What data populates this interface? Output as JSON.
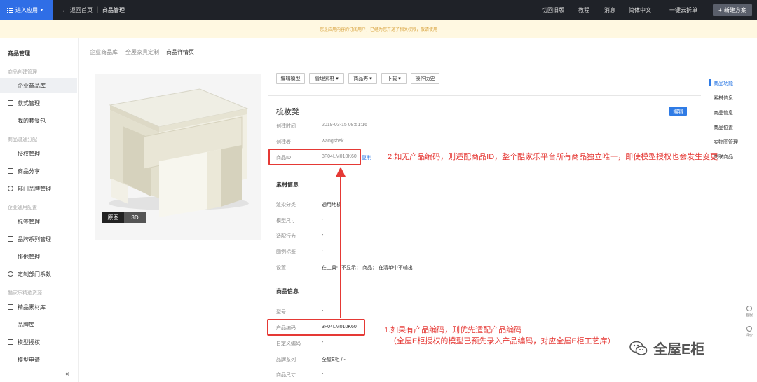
{
  "topbar": {
    "app_button": "进入应用",
    "back": "返回首页",
    "title": "商品管理",
    "right_items": [
      "切回旧版",
      "教程",
      "消息",
      "简体中文",
      "一键云拆单"
    ],
    "new_plan": "新建方案"
  },
  "notice": "您是应用内容的订阅用户，已经为您开通了相关权限，敬请使用",
  "sidebar": {
    "title": "商品管理",
    "groups": [
      {
        "label": "商品创建管理",
        "items": [
          "企业商品库",
          "款式管理",
          "我的套餐包"
        ]
      },
      {
        "label": "商品流通分配",
        "items": [
          "授权管理",
          "商品分享",
          "部门品牌管理"
        ]
      },
      {
        "label": "企业通用配置",
        "items": [
          "标签管理",
          "品牌系列管理",
          "排他管理",
          "定制部门系数"
        ]
      },
      {
        "label": "酷家乐精选资源",
        "items": [
          "精品素材库",
          "品牌库",
          "模型授权",
          "模型申请"
        ]
      }
    ],
    "collapse": "«"
  },
  "breadcrumb": [
    "企业商品库",
    "全屋家具定制",
    "商品详情页"
  ],
  "image_tabs": [
    "原图",
    "3D"
  ],
  "toolbar": [
    "编辑模型",
    "管理素材 ▾",
    "商品秀 ▾",
    "下载 ▾",
    "操作历史"
  ],
  "product": {
    "name": "梳妆凳",
    "edit": "编辑",
    "created_label": "创建时间",
    "created_value": "2019-03-15 08:51:16",
    "creator_label": "创建者",
    "creator_value": "wangshek",
    "id_label": "商品ID",
    "id_value": "3F04LM010K60",
    "id_link": "复制"
  },
  "material": {
    "title": "素材信息",
    "rows": [
      {
        "label": "渲染分类",
        "value": "通用地板"
      },
      {
        "label": "模型尺寸",
        "value": "-"
      },
      {
        "label": "适配行为",
        "value": "-"
      },
      {
        "label": "图例标签",
        "value": "-"
      },
      {
        "label": "设置",
        "value": "在工具中不显示：  商品：  在清单中不输出"
      }
    ]
  },
  "goods": {
    "title": "商品信息",
    "rows": [
      {
        "label": "型号",
        "value": "-"
      },
      {
        "label": "产品编码",
        "value": "3F04LM010K60"
      },
      {
        "label": "自定义编码",
        "value": "-"
      },
      {
        "label": "品牌系列",
        "value": "全屋E柜 / -"
      },
      {
        "label": "商品尺寸",
        "value": "-"
      }
    ]
  },
  "right_nav": [
    "商品功能",
    "素材信息",
    "商品信息",
    "商品位置",
    "实物图管理",
    "关联商品"
  ],
  "float_tools": [
    "客服",
    "评价"
  ],
  "annotations": {
    "note2": "2.如无产品编码，则适配商品ID，整个酷家乐平台所有商品独立唯一，即使模型授权也会发生变更",
    "note1_line1": "1.如果有产品编码，则优先适配产品编码",
    "note1_line2": "（全屋E柜授权的模型已预先录入产品编码，对应全屋E柜工艺库）"
  },
  "watermark": "全屋E柜",
  "colors": {
    "accent": "#2f7be5",
    "annotation": "#e53935",
    "topbar": "#1f2228",
    "app_button": "#2f6ee6"
  }
}
